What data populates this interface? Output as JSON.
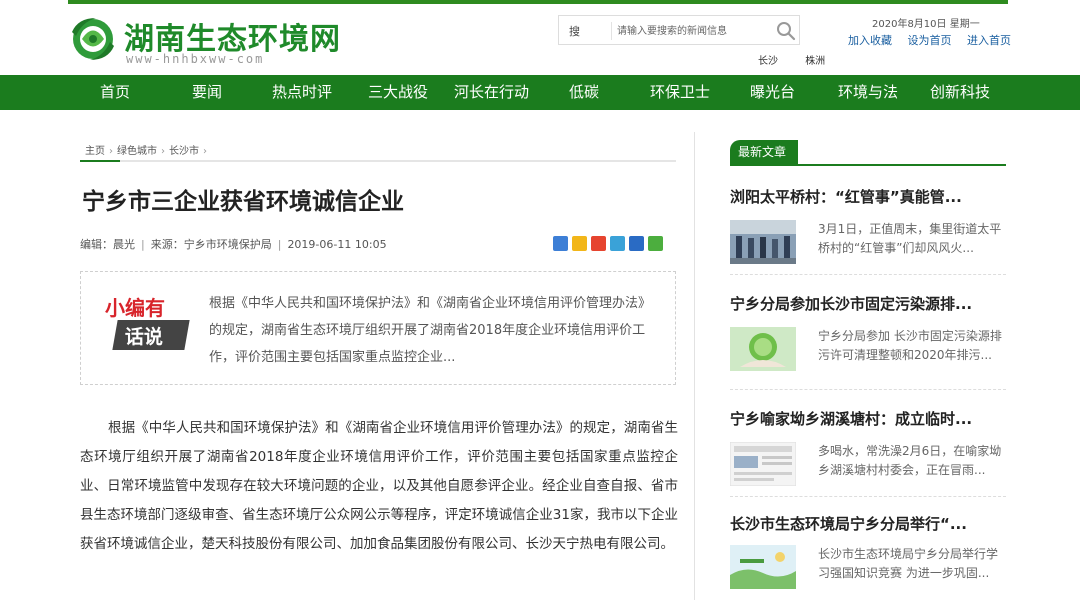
{
  "site": {
    "title": "湖南生态环境网",
    "subtitle": "www-hnhbxww-com"
  },
  "search": {
    "label": "搜",
    "placeholder": "请输入要搜索的新闻信息"
  },
  "cities": [
    "长沙",
    "株洲"
  ],
  "header": {
    "date": "2020年8月10日  星期一",
    "links": [
      "加入收藏",
      "设为首页",
      "进入首页"
    ]
  },
  "nav": [
    "首页",
    "要闻",
    "热点时评",
    "三大战役",
    "河长在行动",
    "低碳",
    "环保卫士",
    "曝光台",
    "环境与法",
    "创新科技"
  ],
  "breadcrumb": [
    "主页",
    "绿色城市",
    "长沙市"
  ],
  "article": {
    "title": "宁乡市三企业获省环境诚信企业",
    "editor": "编辑：晨光",
    "source": "来源：宁乡市环境保护局",
    "datetime": "2019-06-11 10:05",
    "badge_top": "小编有",
    "badge_bottom": "话说",
    "summary": "根据《中华人民共和国环境保护法》和《湖南省企业环境信用评价管理办法》的规定，湖南省生态环境厅组织开展了湖南省2018年度企业环境信用评价工作，评价范围主要包括国家重点监控企业...",
    "body": "根据《中华人民共和国环境保护法》和《湖南省企业环境信用评价管理办法》的规定，湖南省生态环境厅组织开展了湖南省2018年度企业环境信用评价工作，评价范围主要包括国家重点监控企业、日常环境监管中发现存在较大环境问题的企业，以及其他自愿参评企业。经企业自查自报、省市县生态环境部门逐级审查、省生态环境厅公众网公示等程序，评定环境诚信企业31家，我市以下企业获省环境诚信企业，楚天科技股份有限公司、加加食品集团股份有限公司、长沙天宁热电有限公司。"
  },
  "share_icons": [
    "share-plus-icon",
    "qzone-icon",
    "weibo-icon",
    "tencent-weibo-icon",
    "renren-icon",
    "wechat-icon"
  ],
  "sidebar": {
    "tab": "最新文章",
    "items": [
      {
        "title": "浏阳太平桥村：“红管事”真能管...",
        "summary": "3月1日，正值周末，集里街道太平桥村的“红管事”们却风风火..."
      },
      {
        "title": "宁乡分局参加长沙市固定污染源排...",
        "summary": "宁乡分局参加 长沙市固定污染源排污许可清理整顿和2020年排污..."
      },
      {
        "title": "宁乡喻家坳乡湖溪塘村：成立临时...",
        "summary": "多喝水，常洗澡2月6日，在喻家坳乡湖溪塘村村委会，正在冒雨..."
      },
      {
        "title": "长沙市生态环境局宁乡分局举行“...",
        "summary": "长沙市生态环境局宁乡分局举行学习强国知识竞赛 为进一步巩固..."
      }
    ]
  },
  "colors": {
    "brand_green": "#1b7c1e",
    "logo_green": "#1f8a2a",
    "badge_red": "#d8242b",
    "link_blue": "#1a5fa0"
  }
}
